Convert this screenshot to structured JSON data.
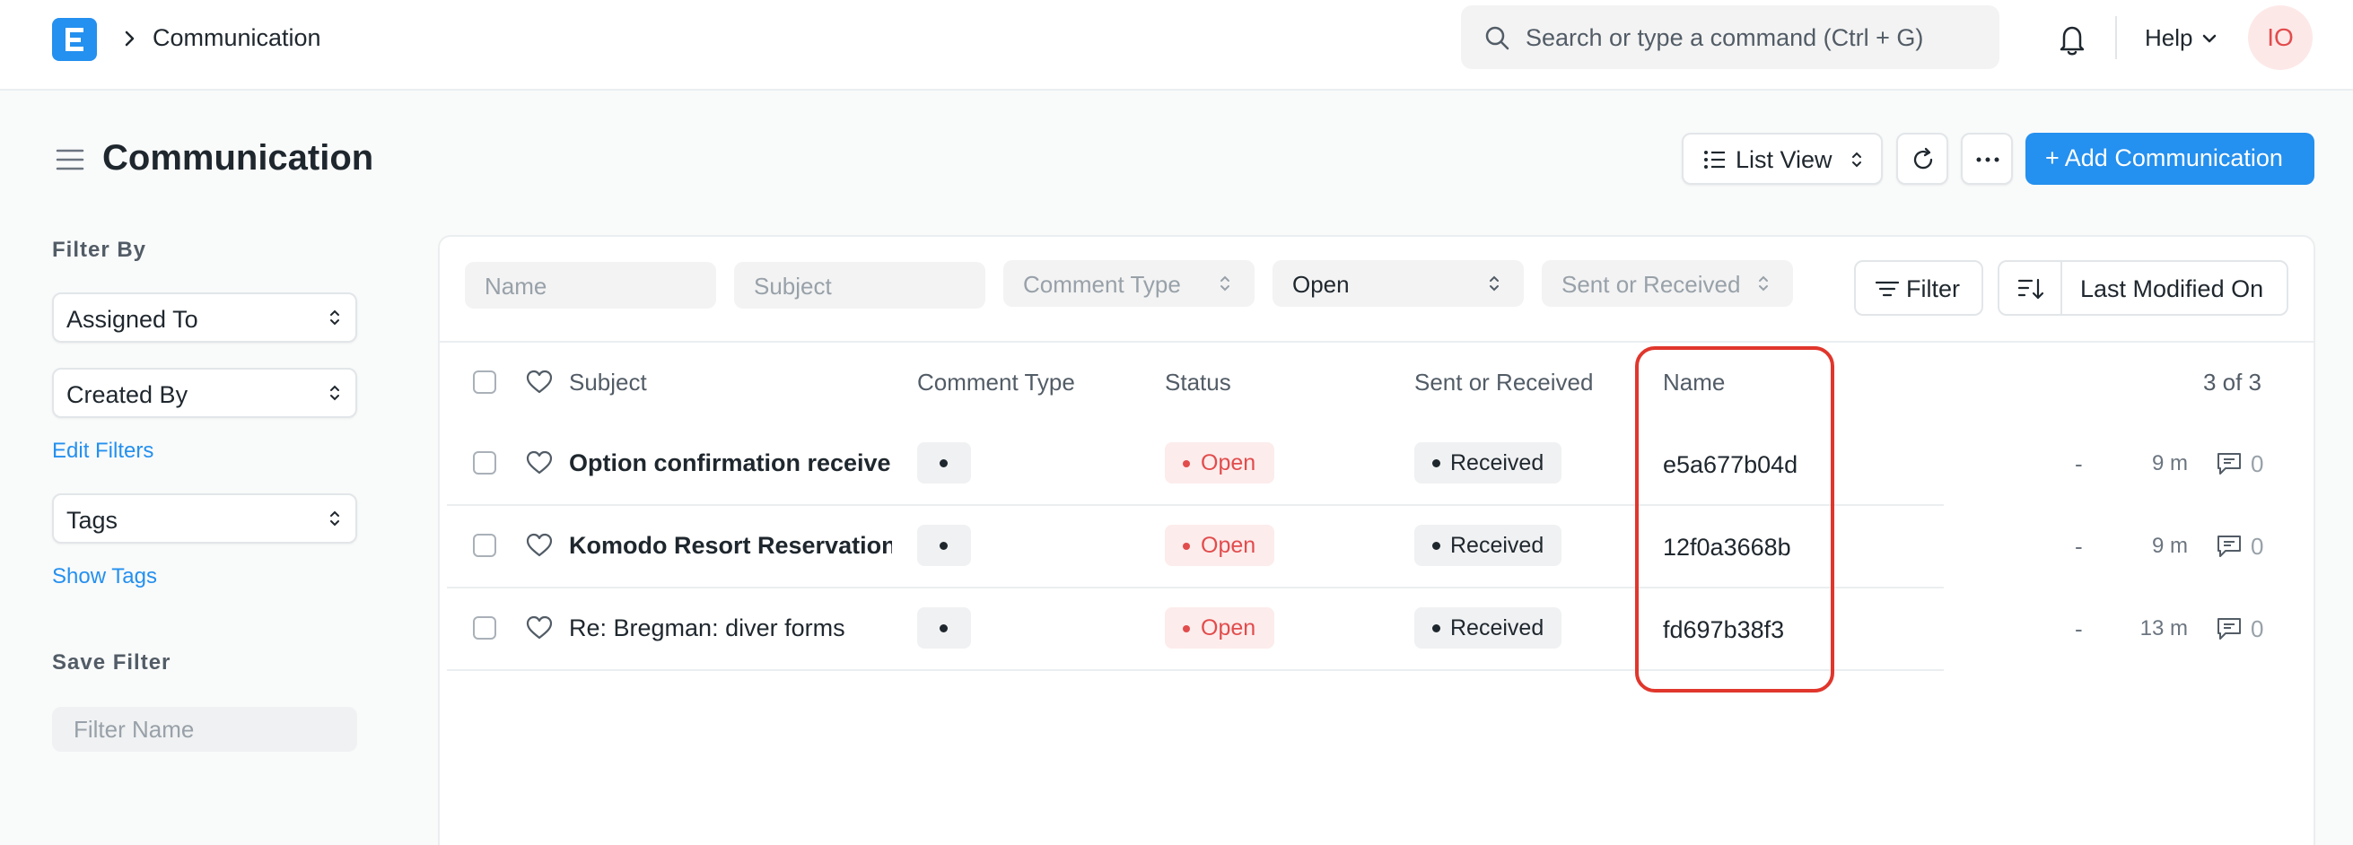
{
  "navbar": {
    "breadcrumb": "Communication",
    "search_placeholder": "Search or type a command (Ctrl + G)",
    "help_label": "Help",
    "avatar_initials": "IO"
  },
  "page": {
    "title": "Communication",
    "list_view_label": "List View",
    "add_button_label": "+ Add Communication"
  },
  "sidebar": {
    "filter_by_label": "Filter By",
    "assigned_to": "Assigned To",
    "created_by": "Created By",
    "edit_filters": "Edit Filters",
    "tags": "Tags",
    "show_tags": "Show Tags",
    "save_filter_label": "Save Filter",
    "filter_name_placeholder": "Filter Name"
  },
  "filters": {
    "name_placeholder": "Name",
    "subject_placeholder": "Subject",
    "comment_type_placeholder": "Comment Type",
    "status_value": "Open",
    "sent_received_placeholder": "Sent or Received",
    "filter_button": "Filter",
    "sort_label": "Last Modified On"
  },
  "table": {
    "columns": {
      "subject": "Subject",
      "comment_type": "Comment Type",
      "status": "Status",
      "sent_or_received": "Sent or Received",
      "name": "Name"
    },
    "count": "3 of 3",
    "rows": [
      {
        "subject": "Option confirmation received",
        "status": "Open",
        "sent_or_received": "Received",
        "name": "e5a677b04d",
        "dash": "-",
        "modified": "9 m",
        "comments": "0"
      },
      {
        "subject": "Komodo Resort Reservation",
        "status": "Open",
        "sent_or_received": "Received",
        "name": "12f0a3668b",
        "dash": "-",
        "modified": "9 m",
        "comments": "0"
      },
      {
        "subject": "Re: Bregman: diver forms",
        "status": "Open",
        "sent_or_received": "Received",
        "name": "fd697b38f3",
        "dash": "-",
        "modified": "13 m",
        "comments": "0"
      }
    ]
  },
  "colors": {
    "primary": "#2490ef",
    "danger": "#e24c4c",
    "highlight": "#e0362c"
  }
}
